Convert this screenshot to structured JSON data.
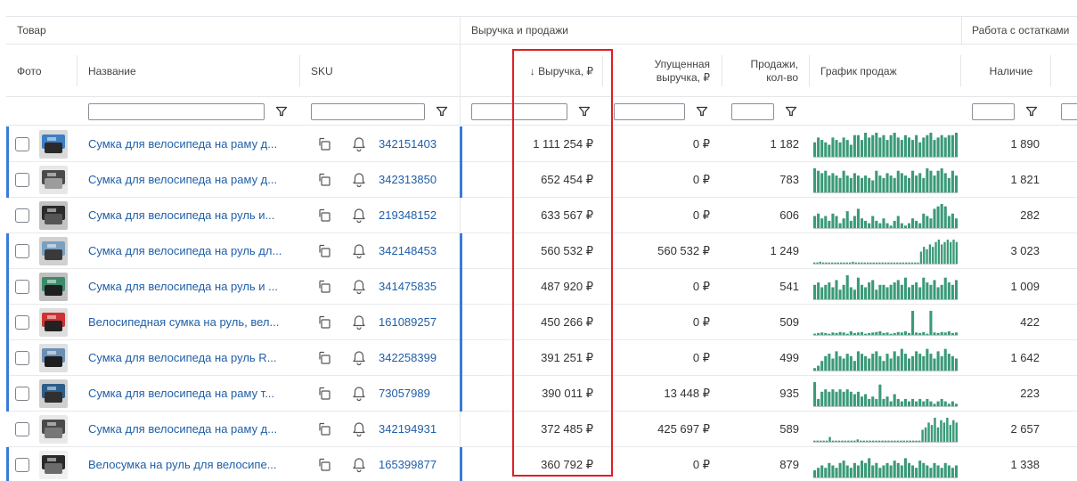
{
  "groups": {
    "product": "Товар",
    "revenue_sales": "Выручка и продажи",
    "stock": "Работа с остатками"
  },
  "columns": {
    "photo": "Фото",
    "name": "Название",
    "sku": "SKU",
    "revenue": "↓ Выручка, ₽",
    "lost_revenue_line1": "Упущенная",
    "lost_revenue_line2": "выручка, ₽",
    "sales_line1": "Продажи,",
    "sales_line2": "кол-во",
    "chart": "График продаж",
    "stock": "Наличие"
  },
  "filters": {
    "name": "",
    "sku": "",
    "revenue": "",
    "lost_revenue": "",
    "sales": "",
    "stock": ""
  },
  "colors": {
    "link": "#1f5fa8",
    "bar": "#3a9a78",
    "accent": "#3a7bd5",
    "highlight": "#e01e24"
  },
  "rows": [
    {
      "name": "Сумка для велосипеда на раму д...",
      "sku": "342151403",
      "revenue": "1 111 254 ₽",
      "lost_revenue": "0 ₽",
      "sales": "1 182",
      "stock": "1 890",
      "accent": true,
      "spark": [
        0.6,
        0.8,
        0.7,
        0.6,
        0.5,
        0.8,
        0.7,
        0.6,
        0.8,
        0.7,
        0.5,
        0.9,
        0.9,
        0.7,
        1.0,
        0.8,
        0.9,
        1.0,
        0.8,
        0.9,
        0.7,
        0.9,
        1.0,
        0.8,
        0.7,
        0.9,
        0.8,
        0.7,
        0.9,
        0.6,
        0.8,
        0.9,
        1.0,
        0.7,
        0.8,
        0.9,
        0.8,
        0.9,
        0.9,
        1.0
      ]
    },
    {
      "name": "Сумка для велосипеда на раму д...",
      "sku": "342313850",
      "revenue": "652 454 ₽",
      "lost_revenue": "0 ₽",
      "sales": "783",
      "stock": "1 821",
      "accent": true,
      "spark": [
        1.0,
        0.9,
        0.8,
        0.9,
        0.7,
        0.8,
        0.7,
        0.6,
        0.9,
        0.7,
        0.6,
        0.8,
        0.7,
        0.6,
        0.7,
        0.6,
        0.5,
        0.9,
        0.7,
        0.6,
        0.8,
        0.7,
        0.6,
        0.9,
        0.8,
        0.7,
        0.6,
        0.9,
        0.7,
        0.8,
        0.6,
        1.0,
        0.9,
        0.7,
        0.9,
        1.0,
        0.8,
        0.6,
        0.9,
        0.7
      ]
    },
    {
      "name": "Сумка для велосипеда на руль и...",
      "sku": "219348152",
      "revenue": "633 567 ₽",
      "lost_revenue": "0 ₽",
      "sales": "606",
      "stock": "282",
      "accent": false,
      "spark": [
        0.5,
        0.6,
        0.4,
        0.5,
        0.3,
        0.6,
        0.5,
        0.2,
        0.4,
        0.7,
        0.3,
        0.5,
        0.8,
        0.4,
        0.3,
        0.2,
        0.5,
        0.3,
        0.2,
        0.4,
        0.2,
        0.1,
        0.3,
        0.5,
        0.2,
        0.1,
        0.2,
        0.4,
        0.3,
        0.2,
        0.6,
        0.5,
        0.4,
        0.8,
        0.9,
        1.0,
        0.9,
        0.5,
        0.6,
        0.4
      ]
    },
    {
      "name": "Сумка для велосипеда на руль дл...",
      "sku": "342148453",
      "revenue": "560 532 ₽",
      "lost_revenue": "560 532 ₽",
      "sales": "1 249",
      "stock": "3 023",
      "accent": true,
      "spark": [
        0.05,
        0.05,
        0.08,
        0.05,
        0.05,
        0.05,
        0.05,
        0.05,
        0.05,
        0.05,
        0.05,
        0.05,
        0.05,
        0.08,
        0.05,
        0.05,
        0.05,
        0.05,
        0.05,
        0.05,
        0.05,
        0.05,
        0.05,
        0.05,
        0.05,
        0.05,
        0.05,
        0.05,
        0.05,
        0.05,
        0.05,
        0.05,
        0.05,
        0.05,
        0.05,
        0.05,
        0.5,
        0.7,
        0.6,
        0.8,
        0.7,
        0.9,
        1.0,
        0.8,
        0.9,
        1.0,
        0.9,
        1.0,
        0.9
      ]
    },
    {
      "name": "Сумка для велосипеда на руль и ...",
      "sku": "341475835",
      "revenue": "487 920 ₽",
      "lost_revenue": "0 ₽",
      "sales": "541",
      "stock": "1 009",
      "accent": true,
      "spark": [
        0.6,
        0.7,
        0.5,
        0.6,
        0.7,
        0.5,
        0.8,
        0.4,
        0.6,
        1.0,
        0.5,
        0.4,
        0.9,
        0.6,
        0.5,
        0.7,
        0.8,
        0.4,
        0.6,
        0.6,
        0.5,
        0.6,
        0.7,
        0.8,
        0.6,
        0.9,
        0.5,
        0.6,
        0.7,
        0.5,
        0.9,
        0.7,
        0.6,
        0.8,
        0.5,
        0.6,
        0.9,
        0.7,
        0.6,
        0.8
      ]
    },
    {
      "name": "Велосипедная сумка на руль, вел...",
      "sku": "161089257",
      "revenue": "450 266 ₽",
      "lost_revenue": "0 ₽",
      "sales": "509",
      "stock": "422",
      "accent": true,
      "spark": [
        0.05,
        0.08,
        0.1,
        0.08,
        0.05,
        0.1,
        0.08,
        0.12,
        0.1,
        0.05,
        0.15,
        0.08,
        0.1,
        0.12,
        0.05,
        0.08,
        0.1,
        0.12,
        0.15,
        0.08,
        0.1,
        0.05,
        0.08,
        0.12,
        0.1,
        0.15,
        0.08,
        1.0,
        0.1,
        0.08,
        0.12,
        0.05,
        1.0,
        0.1,
        0.08,
        0.12,
        0.1,
        0.15,
        0.08,
        0.1
      ]
    },
    {
      "name": "Сумка для велосипеда на руль R...",
      "sku": "342258399",
      "revenue": "391 251 ₽",
      "lost_revenue": "0 ₽",
      "sales": "499",
      "stock": "1 642",
      "accent": true,
      "spark": [
        0.1,
        0.2,
        0.4,
        0.6,
        0.7,
        0.5,
        0.8,
        0.6,
        0.5,
        0.7,
        0.6,
        0.4,
        0.8,
        0.7,
        0.6,
        0.5,
        0.7,
        0.8,
        0.6,
        0.4,
        0.7,
        0.5,
        0.8,
        0.6,
        0.9,
        0.7,
        0.5,
        0.6,
        0.8,
        0.7,
        0.6,
        0.9,
        0.7,
        0.5,
        0.8,
        0.6,
        0.9,
        0.7,
        0.6,
        0.5
      ]
    },
    {
      "name": "Сумка для велосипеда на раму т...",
      "sku": "73057989",
      "revenue": "390 011 ₽",
      "lost_revenue": "13 448 ₽",
      "sales": "935",
      "stock": "223",
      "accent": true,
      "spark": [
        1.0,
        0.3,
        0.6,
        0.7,
        0.6,
        0.7,
        0.6,
        0.7,
        0.6,
        0.7,
        0.6,
        0.5,
        0.6,
        0.4,
        0.5,
        0.3,
        0.4,
        0.3,
        0.9,
        0.3,
        0.4,
        0.2,
        0.5,
        0.3,
        0.2,
        0.3,
        0.2,
        0.3,
        0.2,
        0.3,
        0.2,
        0.3,
        0.2,
        0.1,
        0.2,
        0.3,
        0.2,
        0.1,
        0.2,
        0.1
      ]
    },
    {
      "name": "Сумка для велосипеда на раму д...",
      "sku": "342194931",
      "revenue": "372 485 ₽",
      "lost_revenue": "425 697 ₽",
      "sales": "589",
      "stock": "2 657",
      "accent": false,
      "spark": [
        0.05,
        0.05,
        0.05,
        0.05,
        0.05,
        0.2,
        0.05,
        0.05,
        0.05,
        0.05,
        0.05,
        0.05,
        0.05,
        0.05,
        0.1,
        0.05,
        0.05,
        0.05,
        0.05,
        0.05,
        0.05,
        0.05,
        0.05,
        0.05,
        0.05,
        0.05,
        0.05,
        0.05,
        0.05,
        0.05,
        0.05,
        0.05,
        0.05,
        0.05,
        0.05,
        0.5,
        0.6,
        0.8,
        0.7,
        1.0,
        0.6,
        0.9,
        0.8,
        1.0,
        0.7,
        0.9,
        0.8
      ]
    },
    {
      "name": "Велосумка на руль для велосипе...",
      "sku": "165399877",
      "revenue": "360 792 ₽",
      "lost_revenue": "0 ₽",
      "sales": "879",
      "stock": "1 338",
      "accent": true,
      "spark": [
        0.3,
        0.4,
        0.5,
        0.4,
        0.6,
        0.5,
        0.4,
        0.6,
        0.7,
        0.5,
        0.4,
        0.6,
        0.5,
        0.7,
        0.6,
        0.8,
        0.5,
        0.6,
        0.4,
        0.5,
        0.6,
        0.5,
        0.7,
        0.6,
        0.5,
        0.8,
        0.6,
        0.5,
        0.4,
        0.7,
        0.6,
        0.5,
        0.4,
        0.6,
        0.5,
        0.4,
        0.6,
        0.5,
        0.4,
        0.5
      ]
    }
  ]
}
